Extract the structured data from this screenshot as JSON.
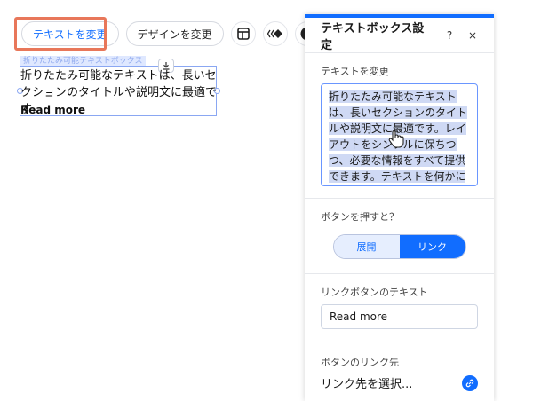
{
  "toolbar": {
    "change_text_label": "テキストを変更",
    "change_design_label": "デザインを変更"
  },
  "canvas": {
    "selection_label": "折りたたみ可能テキストボックス",
    "body_text": "折りたたみ可能なテキストは、長いセクションのタイトルや説明文に最適です…",
    "read_more": "Read more"
  },
  "panel": {
    "title": "テキストボックス設定",
    "help_label": "?",
    "close_label": "×",
    "text_section_label": "テキストを変更",
    "text_value": "折りたたみ可能なテキストは、長いセクションのタイトルや説明文に最適です。レイアウトをシンプルに保ちつつ、必要な情報をすべて提供できます。テキストを何かに",
    "button_action_label": "ボタンを押すと？",
    "toggle_options": [
      "展開",
      "リンク"
    ],
    "toggle_selected": "リンク",
    "link_text_label": "リンクボタンのテキスト",
    "link_text_value": "Read more",
    "link_target_label": "ボタンのリンク先",
    "link_target_value": "リンク先を選択..."
  },
  "colors": {
    "accent": "#116dff",
    "highlight_border": "#e8775a"
  }
}
